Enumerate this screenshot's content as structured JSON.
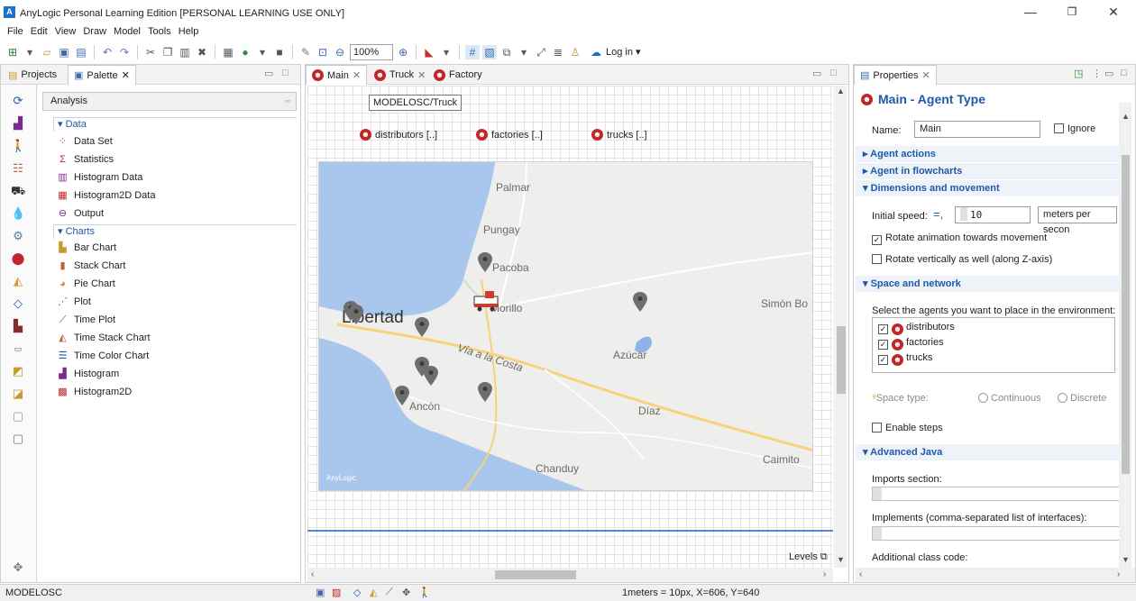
{
  "window": {
    "title": "AnyLogic Personal Learning Edition [PERSONAL LEARNING USE ONLY]",
    "app_icon_text": "A",
    "min_glyph": "—",
    "max_glyph": "❐",
    "close_glyph": "✕"
  },
  "menu": [
    "File",
    "Edit",
    "View",
    "Draw",
    "Model",
    "Tools",
    "Help"
  ],
  "toolbar": {
    "zoom": "100%",
    "login_label": "Log in"
  },
  "left_panel": {
    "tabs": [
      {
        "label": "Projects"
      },
      {
        "label": "Palette",
        "close": "✕"
      }
    ],
    "min_glyph": "▭",
    "max_glyph": "□",
    "category": "Analysis",
    "category_toggle": "▫▫",
    "groups": [
      {
        "label": "Data",
        "items": [
          "Data Set",
          "Statistics",
          "Histogram Data",
          "Histogram2D Data",
          "Output"
        ]
      },
      {
        "label": "Charts",
        "items": [
          "Bar Chart",
          "Stack Chart",
          "Pie Chart",
          "Plot",
          "Time Plot",
          "Time Stack Chart",
          "Time Color Chart",
          "Histogram",
          "Histogram2D"
        ]
      }
    ],
    "bottom_icon": "✥"
  },
  "editor": {
    "tabs": [
      {
        "label": "Main"
      },
      {
        "label": "Truck"
      },
      {
        "label": "Factory"
      }
    ],
    "tooltip": "MODELOSC/Truck",
    "agents": [
      "distributors [..]",
      "factories [..]",
      "trucks [..]"
    ],
    "map": {
      "towns": [
        "Palmar",
        "Pungay",
        "Pacoba",
        "Morillo",
        "Simón Bo",
        "Libertad",
        "Vía a la Costa",
        "Azúcar",
        "Ancón",
        "Díaz",
        "Chanduy",
        "Caimito"
      ],
      "watermark": "AnyLogic"
    },
    "levels": "Levels",
    "min_glyph": "▭",
    "max_glyph": "□"
  },
  "properties": {
    "tab": "Properties",
    "min_glyph": "▭",
    "max_glyph": "□",
    "title": "Main - Agent Type",
    "name_label": "Name:",
    "name_value": "Main",
    "ignore_label": "Ignore",
    "sections": {
      "agent_actions": "Agent actions",
      "agent_flowcharts": "Agent in flowcharts",
      "dimensions": "Dimensions and movement",
      "space": "Space and network",
      "advanced": "Advanced Java"
    },
    "initial_speed_label": "Initial speed:",
    "initial_speed_value": "10",
    "speed_unit": "meters per secon",
    "rotate_label": "Rotate animation towards movement",
    "rotate_vert_label": "Rotate vertically as well (along Z-axis)",
    "select_agents_label": "Select the agents you want to place in the environment:",
    "env_agents": [
      "distributors",
      "factories",
      "trucks"
    ],
    "space_type_label": "Space type:",
    "space_options": [
      "Continuous",
      "Discrete"
    ],
    "enable_steps_label": "Enable steps",
    "imports_label": "Imports section:",
    "implements_label": "Implements (comma-separated list of interfaces):",
    "additional_label": "Additional class code:"
  },
  "status": {
    "left": "MODELOSC",
    "coords": "1meters = 10px, X=606, Y=640"
  },
  "colors": {
    "accent": "#1d5aa8",
    "agent_red": "#c0262a",
    "sea": "#a9c6ec"
  }
}
